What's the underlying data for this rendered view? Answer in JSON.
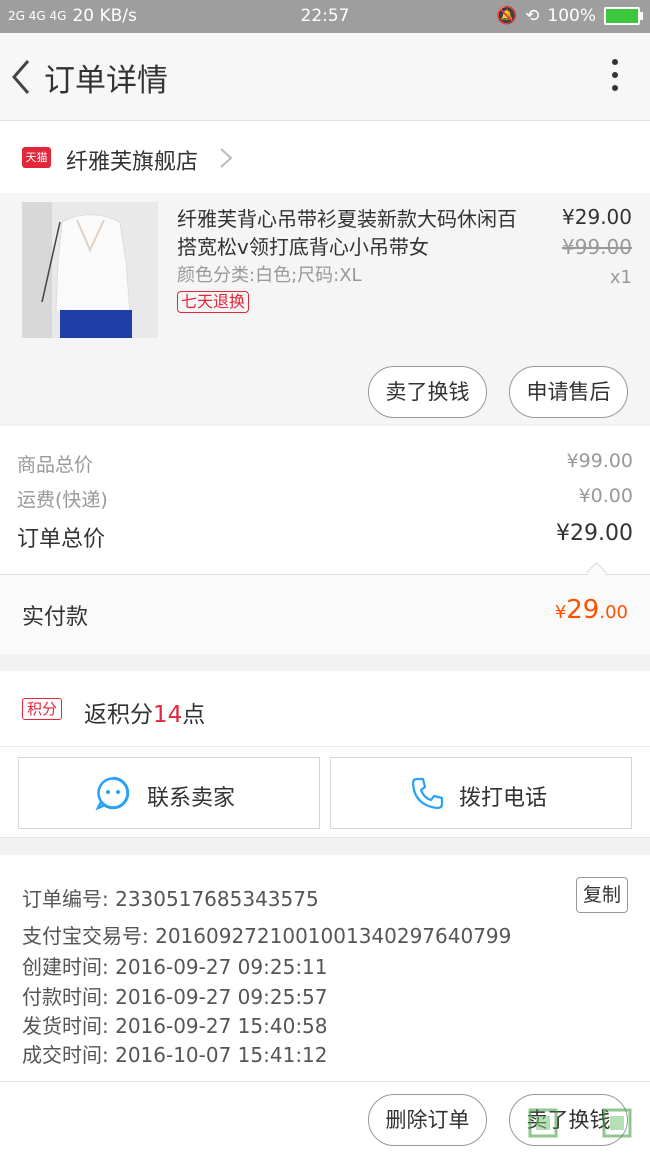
{
  "status_bar": {
    "network": "2G  4G 4G",
    "speed": "20 KB/s",
    "time": "22:57",
    "battery": "100%"
  },
  "header": {
    "title": "订单详情"
  },
  "store": {
    "logo_text": "天猫",
    "name": "纤雅芙旗舰店"
  },
  "product": {
    "title": "纤雅芙背心吊带衫夏装新款大码休闲百搭宽松v领打底背心小吊带女",
    "spec": "颜色分类:白色;尺码:XL",
    "badge": "七天退换",
    "price": "¥29.00",
    "original_price": "¥99.00",
    "quantity": "x1",
    "sell_button": "卖了换钱",
    "after_sale_button": "申请售后"
  },
  "summary": {
    "goods_total_label": "商品总价",
    "goods_total_value": "¥99.00",
    "shipping_label": "运费(快递)",
    "shipping_value": "¥0.00",
    "order_total_label": "订单总价",
    "order_total_value": "¥29.00"
  },
  "paid": {
    "label": "实付款",
    "currency": "¥",
    "integer": "29",
    "decimal": ".00"
  },
  "points": {
    "badge": "积分",
    "text_prefix": "返积分",
    "number": "14",
    "text_suffix": "点"
  },
  "contact": {
    "seller_button": "联系卖家",
    "call_button": "拨打电话"
  },
  "order_info": {
    "copy_button": "复制",
    "order_number": "订单编号: 2330517685343575",
    "alipay_number": "支付宝交易号: 2016092721001001340297640799",
    "created": "创建时间: 2016-09-27 09:25:11",
    "paid": "付款时间: 2016-09-27 09:25:57",
    "shipped": "发货时间: 2016-09-27 15:40:58",
    "completed": "成交时间: 2016-10-07 15:41:12"
  },
  "bottom_bar": {
    "delete_button": "删除订单",
    "sell_button": "卖了换钱"
  },
  "colors": {
    "accent_red": "#e4263b",
    "price_orange": "#ff5000"
  }
}
